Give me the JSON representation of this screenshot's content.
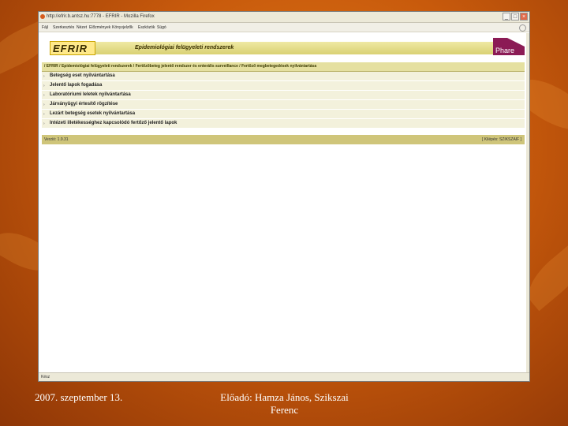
{
  "window": {
    "title": "http://efrir.b.antsz.hu:7778 - EFRIR - Mozilla Firefox",
    "buttons": [
      "_",
      "□",
      "×"
    ]
  },
  "menubar": [
    "Fájl",
    "Szerkesztés",
    "Nézet",
    "Előzmények",
    "Könyvjelzők",
    "Eszközök",
    "Súgó"
  ],
  "banner": {
    "logo": "EFRIR",
    "subtitle": "Epidemiológiai felügyeleti rendszerek",
    "phare": "Phare"
  },
  "breadcrumb": "/ EFRIR / Epidemiológiai felügyeleti rendszerek / Fertőzőbeteg jelentő rendszer és enterális surveillance / Fertőző megbetegedések nyilvántartása",
  "menu_items": [
    "Betegség eset nyilvántartása",
    "Jelentő lapok fogadása",
    "Laboratóriumi leletek nyilvántartása",
    "Járványügyi értesítő rögzítése",
    "Lezárt betegség esetek nyilvántartása",
    "Intézeti illetékességhez kapcsolódó fertőző jelentő lapok"
  ],
  "version": "Verzió: 1.9.31",
  "logout": "[ Kilépés: SZIKSZAIF ]",
  "status": "Kész",
  "footer": {
    "date": "2007. szeptember 13.",
    "presenter": "Előadó: Hamza János, Szikszai Ferenc"
  }
}
